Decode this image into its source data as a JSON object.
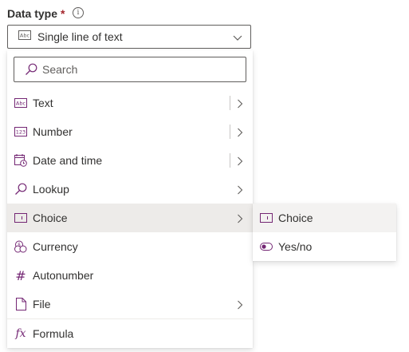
{
  "field": {
    "label": "Data type",
    "required_mark": "*",
    "info_glyph": "i",
    "selected_value": "Single line of text",
    "selected_icon": "text-abc-icon"
  },
  "search": {
    "placeholder": "Search",
    "value": ""
  },
  "menu": {
    "items": [
      {
        "label": "Text",
        "icon": "text-abc-icon",
        "has_submenu": true,
        "has_separator": true
      },
      {
        "label": "Number",
        "icon": "number-123-icon",
        "has_submenu": true,
        "has_separator": true
      },
      {
        "label": "Date and time",
        "icon": "calendar-clock-icon",
        "has_submenu": true,
        "has_separator": true
      },
      {
        "label": "Lookup",
        "icon": "lookup-search-icon",
        "has_submenu": true,
        "has_separator": false
      },
      {
        "label": "Choice",
        "icon": "choice-dropdown-icon",
        "has_submenu": true,
        "has_separator": false,
        "selected": true
      },
      {
        "label": "Currency",
        "icon": "currency-icon",
        "has_submenu": false
      },
      {
        "label": "Autonumber",
        "icon": "hash-icon",
        "glyph": "#",
        "has_submenu": false
      },
      {
        "label": "File",
        "icon": "file-icon",
        "has_submenu": true,
        "has_separator": false
      },
      {
        "label": "Formula",
        "icon": "formula-fx-icon",
        "glyph": "fx",
        "has_submenu": false
      }
    ]
  },
  "submenu": {
    "items": [
      {
        "label": "Choice",
        "icon": "choice-dropdown-icon",
        "hovered": true
      },
      {
        "label": "Yes/no",
        "icon": "toggle-icon"
      }
    ]
  },
  "colors": {
    "icon_accent": "#742774",
    "selected_bg": "#edebe9",
    "submenu_hover_bg": "#f3f2f1",
    "required": "#a4262c",
    "text": "#323130"
  }
}
